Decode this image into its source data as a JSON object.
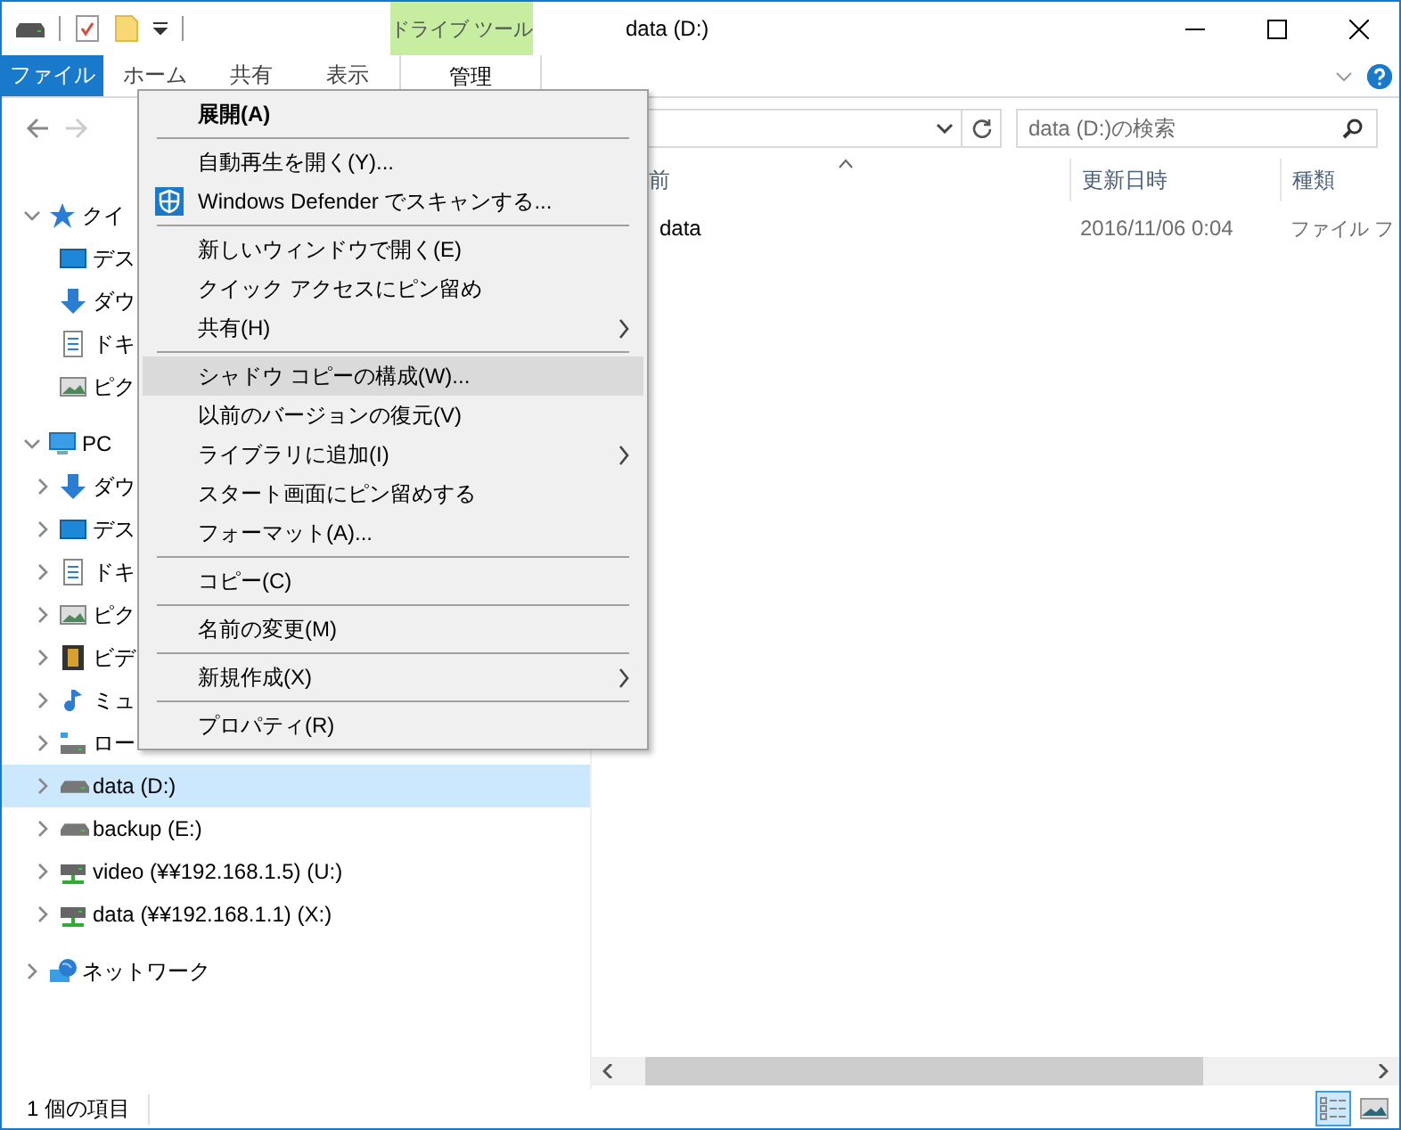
{
  "window": {
    "title": "data (D:)",
    "context_group": "ドライブ ツール"
  },
  "ribbon_tabs": [
    {
      "label": "ファイル",
      "kind": "file"
    },
    {
      "label": "ホーム",
      "kind": "normal"
    },
    {
      "label": "共有",
      "kind": "normal"
    },
    {
      "label": "表示",
      "kind": "normal"
    },
    {
      "label": "管理",
      "kind": "context"
    }
  ],
  "search": {
    "placeholder": "data (D:)の検索"
  },
  "navigation": [
    {
      "label": "クイ",
      "kind": "quick-access",
      "expanded": true,
      "selected": false,
      "children": [
        {
          "label": "デス",
          "kind": "desktop",
          "selected": false
        },
        {
          "label": "ダウ",
          "kind": "download",
          "selected": false
        },
        {
          "label": "ドキ",
          "kind": "document",
          "selected": false
        },
        {
          "label": "ピク",
          "kind": "picture",
          "selected": false
        }
      ]
    },
    {
      "label": "PC",
      "kind": "pc",
      "expanded": true,
      "selected": false,
      "children": [
        {
          "label": "ダウ",
          "kind": "download",
          "expanded": false,
          "selected": false
        },
        {
          "label": "デス",
          "kind": "desktop",
          "expanded": false,
          "selected": false
        },
        {
          "label": "ドキ",
          "kind": "document",
          "expanded": false,
          "selected": false
        },
        {
          "label": "ピク",
          "kind": "picture",
          "expanded": false,
          "selected": false
        },
        {
          "label": "ビデ",
          "kind": "video",
          "expanded": false,
          "selected": false
        },
        {
          "label": "ミュ",
          "kind": "music",
          "expanded": false,
          "selected": false
        },
        {
          "label": "ロー",
          "kind": "local-drive",
          "expanded": false,
          "selected": false
        },
        {
          "label": "data (D:)",
          "kind": "drive",
          "expanded": false,
          "selected": true
        },
        {
          "label": "backup (E:)",
          "kind": "drive",
          "expanded": false,
          "selected": false
        },
        {
          "label": "video (¥¥192.168.1.5) (U:)",
          "kind": "network-drive",
          "expanded": false,
          "selected": false
        },
        {
          "label": "data (¥¥192.168.1.1) (X:)",
          "kind": "network-drive",
          "expanded": false,
          "selected": false
        }
      ]
    },
    {
      "label": "ネットワーク",
      "kind": "network",
      "expanded": false,
      "selected": false
    }
  ],
  "columns": [
    {
      "label": "前",
      "sorted": true
    },
    {
      "label": "更新日時",
      "sorted": false
    },
    {
      "label": "種類",
      "sorted": false
    }
  ],
  "rows": [
    {
      "name": "data",
      "modified": "2016/11/06 0:04",
      "type": "ファイル フ"
    }
  ],
  "context_menu": [
    {
      "kind": "item",
      "label": "展開(A)",
      "bold": true,
      "highlighted": false,
      "submenu": false
    },
    {
      "kind": "separator"
    },
    {
      "kind": "item",
      "label": "自動再生を開く(Y)...",
      "bold": false,
      "highlighted": false,
      "submenu": false
    },
    {
      "kind": "shield-item",
      "label": "Windows Defender でスキャンする...",
      "bold": false,
      "highlighted": false,
      "submenu": false
    },
    {
      "kind": "separator"
    },
    {
      "kind": "item",
      "label": "新しいウィンドウで開く(E)",
      "bold": false,
      "highlighted": false,
      "submenu": false
    },
    {
      "kind": "item",
      "label": "クイック アクセスにピン留め",
      "bold": false,
      "highlighted": false,
      "submenu": false
    },
    {
      "kind": "item",
      "label": "共有(H)",
      "bold": false,
      "highlighted": false,
      "submenu": true
    },
    {
      "kind": "separator"
    },
    {
      "kind": "item",
      "label": "シャドウ コピーの構成(W)...",
      "bold": false,
      "highlighted": true,
      "submenu": false
    },
    {
      "kind": "item",
      "label": "以前のバージョンの復元(V)",
      "bold": false,
      "highlighted": false,
      "submenu": false
    },
    {
      "kind": "item",
      "label": "ライブラリに追加(I)",
      "bold": false,
      "highlighted": false,
      "submenu": true
    },
    {
      "kind": "item",
      "label": "スタート画面にピン留めする",
      "bold": false,
      "highlighted": false,
      "submenu": false
    },
    {
      "kind": "item",
      "label": "フォーマット(A)...",
      "bold": false,
      "highlighted": false,
      "submenu": false
    },
    {
      "kind": "separator"
    },
    {
      "kind": "item",
      "label": "コピー(C)",
      "bold": false,
      "highlighted": false,
      "submenu": false
    },
    {
      "kind": "separator"
    },
    {
      "kind": "item",
      "label": "名前の変更(M)",
      "bold": false,
      "highlighted": false,
      "submenu": false
    },
    {
      "kind": "separator"
    },
    {
      "kind": "item",
      "label": "新規作成(X)",
      "bold": false,
      "highlighted": false,
      "submenu": true
    },
    {
      "kind": "separator"
    },
    {
      "kind": "item",
      "label": "プロパティ(R)",
      "bold": false,
      "highlighted": false,
      "submenu": false
    }
  ],
  "status_bar": {
    "item_count": "1 個の項目",
    "views": [
      {
        "kind": "details",
        "selected": true
      },
      {
        "kind": "large-icons",
        "selected": false
      }
    ]
  }
}
